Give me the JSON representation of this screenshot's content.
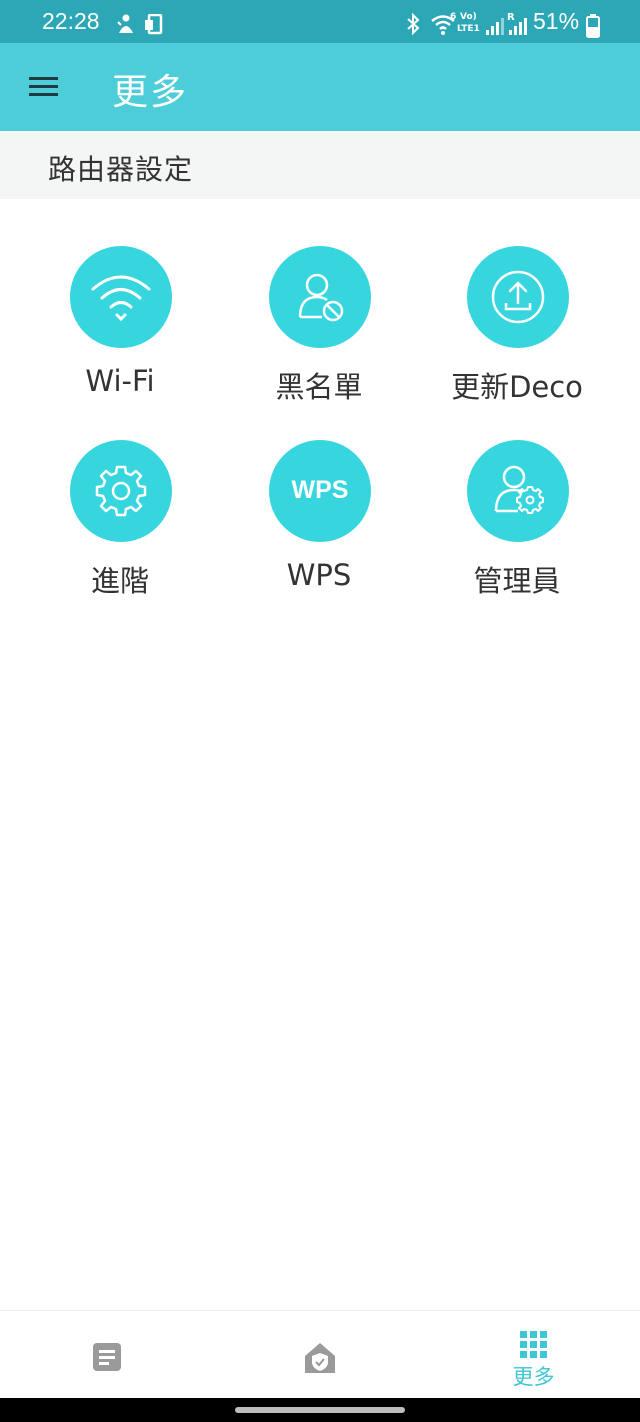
{
  "status_bar": {
    "time": "22:28",
    "battery_percent": "51%",
    "volte": "Vo)",
    "lte": "LTE1",
    "wifi_band": "6",
    "roaming": "R"
  },
  "app_bar": {
    "title": "更多"
  },
  "section": {
    "title": "路由器設定"
  },
  "grid_items": [
    {
      "label": "Wi-Fi",
      "icon": "wifi-icon"
    },
    {
      "label": "黑名單",
      "icon": "user-block-icon"
    },
    {
      "label": "更新Deco",
      "icon": "upload-icon"
    },
    {
      "label": "進階",
      "icon": "gear-icon"
    },
    {
      "label": "WPS",
      "icon": "wps-icon",
      "icon_text": "WPS"
    },
    {
      "label": "管理員",
      "icon": "user-gear-icon"
    }
  ],
  "bottom_nav": {
    "active": "more",
    "tabs": [
      {
        "id": "log",
        "icon": "document-icon",
        "label": ""
      },
      {
        "id": "home",
        "icon": "home-shield-icon",
        "label": ""
      },
      {
        "id": "more",
        "icon": "grid-icon",
        "label": "更多"
      }
    ]
  },
  "colors": {
    "accent": "#4ccdd8",
    "icon_circle": "#37d6df",
    "status_bar": "#2ba7b6",
    "inactive_icon": "#9a9a9a"
  }
}
